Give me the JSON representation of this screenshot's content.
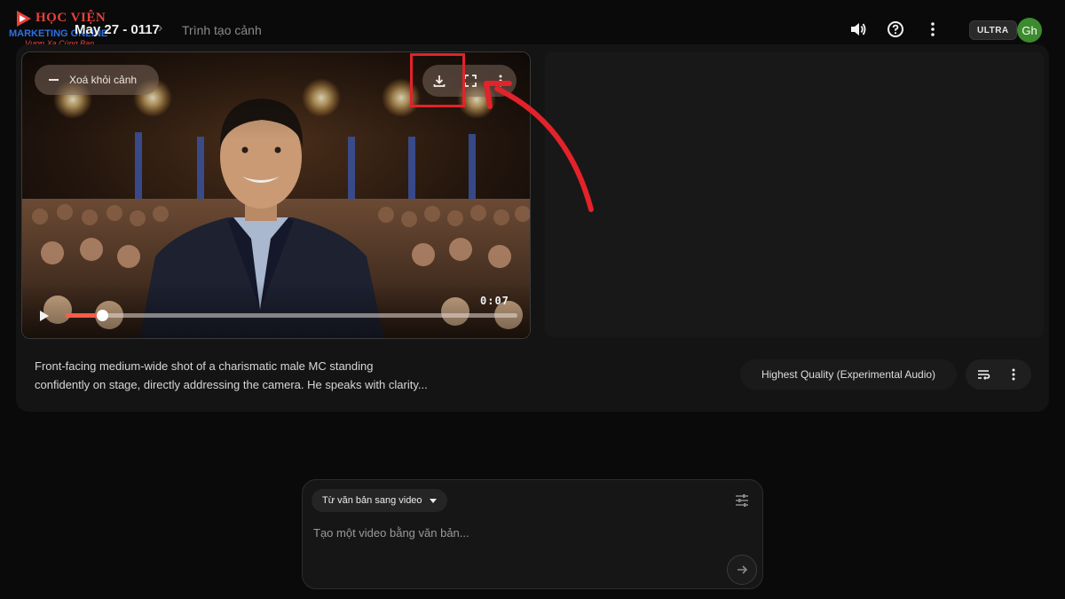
{
  "header": {
    "logo": {
      "line1": "HỌC VIỆN",
      "line2": "MARKETING ONLINE",
      "line3": "Vươn Xa Cùng Bạn"
    },
    "breadcrumb": {
      "project": "May 27 - 0117",
      "separator": "›",
      "current": "Trình tạo cảnh"
    },
    "icons": [
      "volume-icon",
      "help-icon",
      "more-vert-icon"
    ],
    "plan_badge": "ULTRA",
    "avatar_initials": "Gh",
    "avatar_color": "#3c8b2e"
  },
  "scene": {
    "remove_button_label": "Xoá khỏi cảnh",
    "toolbar_icons": [
      "download-icon",
      "fullscreen-icon",
      "more-vert-icon"
    ],
    "timecode": "0:07",
    "progress": 0.08,
    "description_line1": "Front-facing medium-wide shot of a charismatic male MC standing",
    "description_line2": "confidently on stage, directly addressing the camera. He speaks with clarity...",
    "quality_label": "Highest Quality (Experimental Audio)",
    "action_icons": [
      "prompt-list-icon",
      "more-vert-icon"
    ]
  },
  "annotation": {
    "color": "#e3222a",
    "target": "download-button"
  },
  "composer": {
    "mode_label": "Từ văn bản sang video",
    "placeholder": "Tạo một video bằng văn bản...",
    "value": "",
    "icons": [
      "tune-icon",
      "arrow-right-icon"
    ]
  },
  "colors": {
    "background": "#0a0a0a",
    "card": "#141414",
    "accent_progress": "#ff5a4a"
  }
}
